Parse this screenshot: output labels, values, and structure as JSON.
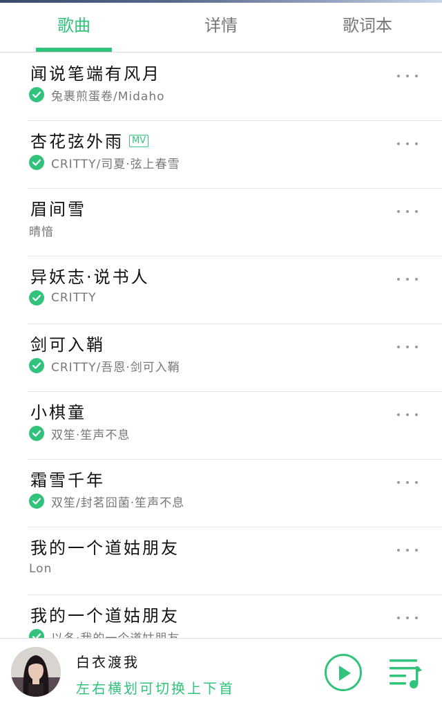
{
  "tabs": [
    {
      "label": "歌曲",
      "active": true
    },
    {
      "label": "详情",
      "active": false
    },
    {
      "label": "歌词本",
      "active": false
    }
  ],
  "songs": [
    {
      "title": "闻说笔端有风月",
      "artist": "兔裹煎蛋卷/Midaho",
      "downloaded": true,
      "mv": false
    },
    {
      "title": "杏花弦外雨",
      "artist": "CRITTY/司夏·弦上春雪",
      "downloaded": true,
      "mv": true,
      "mv_label": "MV"
    },
    {
      "title": "眉间雪",
      "artist": "晴愔",
      "downloaded": false,
      "mv": false
    },
    {
      "title": "异妖志·说书人",
      "artist": "CRITTY",
      "downloaded": true,
      "mv": false
    },
    {
      "title": "剑可入鞘",
      "artist": "CRITTY/吾恩·剑可入鞘",
      "downloaded": true,
      "mv": false
    },
    {
      "title": "小棋童",
      "artist": "双笙·笙声不息",
      "downloaded": true,
      "mv": false
    },
    {
      "title": "霜雪千年",
      "artist": "双笙/封茗囧菌·笙声不息",
      "downloaded": true,
      "mv": false
    },
    {
      "title": "我的一个道姑朋友",
      "artist": "Lon",
      "downloaded": false,
      "mv": false
    },
    {
      "title": "我的一个道姑朋友",
      "artist": "以冬·我的一个道姑朋友",
      "downloaded": true,
      "mv": false
    }
  ],
  "player": {
    "now_playing_title": "白衣渡我",
    "swipe_hint": "左右横划可切换上下首"
  },
  "colors": {
    "accent": "#31c27c",
    "text_secondary": "#777777",
    "divider": "#e6e6e6"
  },
  "icons": {
    "downloaded": "check-circle-icon",
    "more": "more-dots-icon",
    "play": "play-circle-icon",
    "playlist": "playlist-icon"
  }
}
